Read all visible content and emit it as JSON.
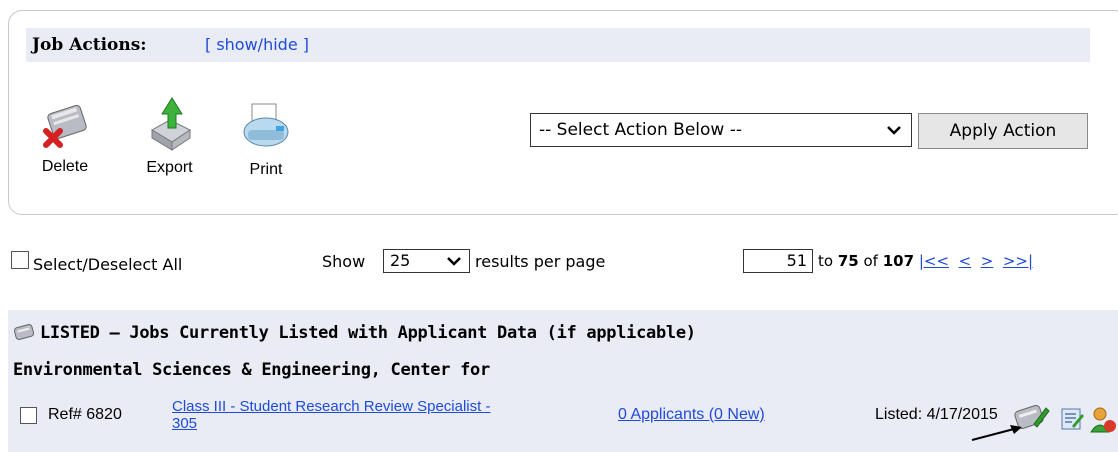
{
  "job_actions": {
    "title": "Job Actions:",
    "toggle_link": "[ show/hide ]",
    "tools": [
      {
        "label": "Delete",
        "icon": "delete-icon"
      },
      {
        "label": "Export",
        "icon": "export-icon"
      },
      {
        "label": "Print",
        "icon": "print-icon"
      }
    ],
    "select_value": "-- Select Action Below --",
    "apply_label": "Apply Action"
  },
  "paging": {
    "select_all_label": "Select/Deselect All",
    "show_label": "Show",
    "per_page_value": "25",
    "results_label": "results per page",
    "start_value": "51",
    "to_label": "to",
    "end": "75",
    "of_label": "of",
    "total": "107",
    "nav": [
      "|<<",
      "<",
      ">",
      ">>|"
    ]
  },
  "listed": {
    "title": "LISTED – Jobs Currently Listed with Applicant Data (if applicable)",
    "department": "Environmental Sciences & Engineering, Center for",
    "job": {
      "ref": "Ref# 6820",
      "title_line1": "Class III - Student Research Review Specialist -",
      "title_line2": "305",
      "applicants": "0 Applicants (0 New)",
      "listed": "Listed: 4/17/2015"
    }
  },
  "colors": {
    "link": "#1f4bd8",
    "header_bg": "#e9ecf5",
    "button_bg": "#e6e6e6"
  }
}
